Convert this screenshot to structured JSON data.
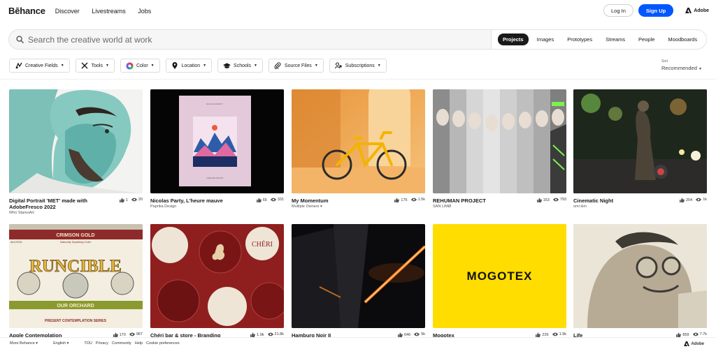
{
  "header": {
    "logo": "Bēhance",
    "nav": [
      "Discover",
      "Livestreams",
      "Jobs"
    ],
    "login": "Log In",
    "signup": "Sign Up",
    "adobe": "Adobe"
  },
  "search": {
    "placeholder": "Search the creative world at work",
    "tabs": [
      "Projects",
      "Images",
      "Prototypes",
      "Streams",
      "People",
      "Moodboards"
    ],
    "active_tab": "Projects"
  },
  "filters": [
    {
      "label": "Creative Fields",
      "icon": "creative-fields-icon"
    },
    {
      "label": "Tools",
      "icon": "tools-icon"
    },
    {
      "label": "Color",
      "icon": "color-wheel-icon"
    },
    {
      "label": "Location",
      "icon": "location-pin-icon"
    },
    {
      "label": "Schools",
      "icon": "graduation-cap-icon"
    },
    {
      "label": "Source Files",
      "icon": "paperclip-icon"
    },
    {
      "label": "Subscriptions",
      "icon": "subscriptions-icon"
    }
  ],
  "sort": {
    "label": "Sort",
    "value": "Recommended"
  },
  "projects": [
    {
      "title": "Digital Portrait 'MET' made with AdobeFresco 2022",
      "owner": "Who StaresArt",
      "likes": "1",
      "views": "20"
    },
    {
      "title": "Nicolas Party, L'heure mauve",
      "owner": "Paprika Design",
      "likes": "65",
      "views": "331"
    },
    {
      "title": "My Momentum",
      "owner": "Multiple Owners ▾",
      "likes": "175",
      "views": "1.5k"
    },
    {
      "title": "REHUMAN PROJECT",
      "owner": "SAN LIMØ",
      "likes": "153",
      "views": "793"
    },
    {
      "title": "Cinematic Night",
      "owner": "omi kim",
      "likes": "204",
      "views": "1k"
    },
    {
      "title": "Apple Contemplation",
      "owner": "",
      "likes": "170",
      "views": "967"
    },
    {
      "title": "Chéri bar & store - Branding",
      "owner": "",
      "likes": "1.9k",
      "views": "21.8k"
    },
    {
      "title": "Hamburg Noir II",
      "owner": "",
      "likes": "646",
      "views": "5k"
    },
    {
      "title": "Mogotex",
      "owner": "",
      "likes": "226",
      "views": "1.9k"
    },
    {
      "title": "Life",
      "owner": "",
      "likes": "859",
      "views": "7.7k"
    }
  ],
  "artwork_text": {
    "paint_note": "NICOLAS PARTY",
    "paint_label": "L'HEURE MAUVE",
    "runcible_top": "CRIMSON GOLD",
    "runcible_sub": "Naturally Sparkling Cider",
    "runcible_abv": "ALC/VOL",
    "runcible_main": "RUNCIBLE",
    "runcible_series": "PRESENT CONTEMPLATION SERIES",
    "runcible_orchard": "OUR ORCHARD",
    "cheri": "CHÉRI",
    "mogotex": "MOGOTEX"
  },
  "footer": {
    "more": "More Behance ▾",
    "lang": "English ▾",
    "links": [
      "TOU",
      "Privacy",
      "Community",
      "Help",
      "Cookie preferences"
    ],
    "adobe": "Adobe"
  },
  "colors": {
    "accent": "#0057ff",
    "text": "#191919"
  }
}
